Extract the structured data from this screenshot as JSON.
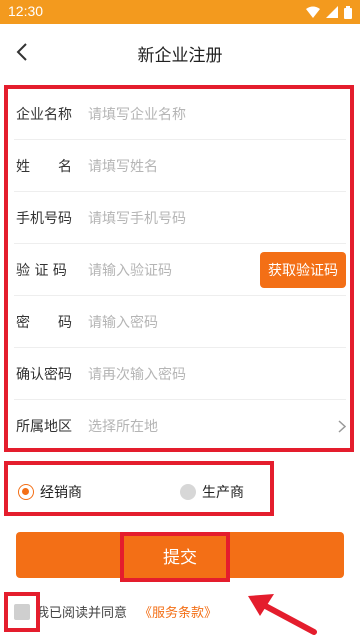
{
  "status_bar": {
    "time": "12:30"
  },
  "header": {
    "title": "新企业注册"
  },
  "form": {
    "fields": [
      {
        "label": "企业名称",
        "placeholder": "请填写企业名称"
      },
      {
        "label": "姓　　名",
        "placeholder": "请填写姓名"
      },
      {
        "label": "手机号码",
        "placeholder": "请填写手机号码"
      },
      {
        "label": "验 证 码",
        "placeholder": "请输入验证码"
      },
      {
        "label": "密　　码",
        "placeholder": "请输入密码"
      },
      {
        "label": "确认密码",
        "placeholder": "请再次输入密码"
      },
      {
        "label": "所属地区",
        "placeholder": "选择所在地"
      }
    ],
    "get_code_label": "获取验证码"
  },
  "type_options": {
    "selected": "经销商",
    "options": [
      "经销商",
      "生产商"
    ]
  },
  "submit_label": "提交",
  "agreement": {
    "text": "我已阅读并同意",
    "terms_link": "《服务条款》",
    "checked": false
  },
  "colors": {
    "accent": "#f36f16",
    "status_bar": "#f39a1e",
    "highlight": "#e41d2d"
  }
}
